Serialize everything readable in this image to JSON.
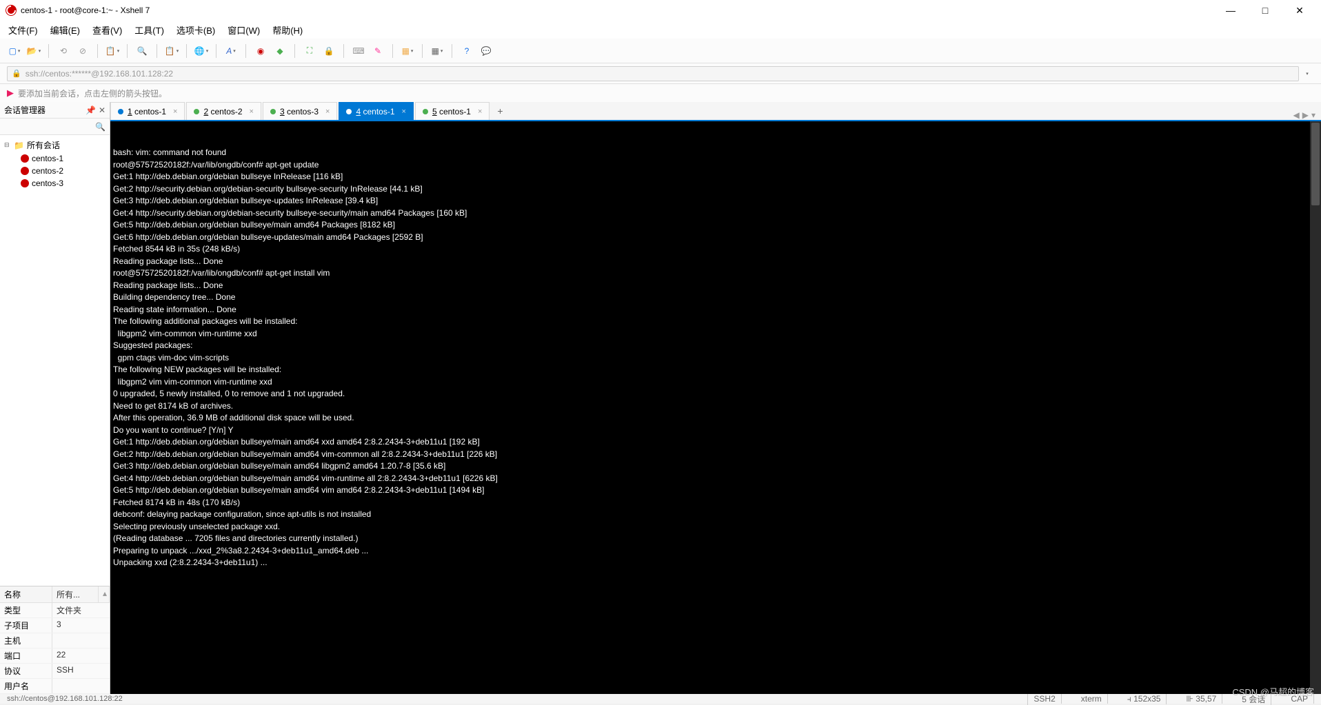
{
  "window": {
    "title": "centos-1 - root@core-1:~ - Xshell 7"
  },
  "menu": {
    "file": "文件(F)",
    "edit": "编辑(E)",
    "view": "查看(V)",
    "tools": "工具(T)",
    "tabs": "选项卡(B)",
    "window": "窗口(W)",
    "help": "帮助(H)"
  },
  "address": {
    "url": "ssh://centos:******@192.168.101.128:22"
  },
  "infobar": {
    "text": "要添加当前会话，点击左侧的箭头按钮。"
  },
  "sidebar": {
    "title": "会话管理器",
    "root": "所有会话",
    "items": [
      "centos-1",
      "centos-2",
      "centos-3"
    ]
  },
  "props": {
    "header_name": "名称",
    "header_all": "所有...",
    "rows": [
      {
        "k": "类型",
        "v": "文件夹"
      },
      {
        "k": "子项目",
        "v": "3"
      },
      {
        "k": "主机",
        "v": ""
      },
      {
        "k": "端口",
        "v": "22"
      },
      {
        "k": "协议",
        "v": "SSH"
      },
      {
        "k": "用户名",
        "v": ""
      }
    ]
  },
  "tabs": {
    "items": [
      {
        "idx": "1",
        "label": "centos-1",
        "dot": "blue",
        "active": false
      },
      {
        "idx": "2",
        "label": "centos-2",
        "dot": "green",
        "active": false
      },
      {
        "idx": "3",
        "label": "centos-3",
        "dot": "green",
        "active": false
      },
      {
        "idx": "4",
        "label": "centos-1",
        "dot": "green",
        "active": true
      },
      {
        "idx": "5",
        "label": "centos-1",
        "dot": "green",
        "active": false
      }
    ]
  },
  "terminal": {
    "lines": [
      "bash: vim: command not found",
      "root@57572520182f:/var/lib/ongdb/conf# apt-get update",
      "Get:1 http://deb.debian.org/debian bullseye InRelease [116 kB]",
      "Get:2 http://security.debian.org/debian-security bullseye-security InRelease [44.1 kB]",
      "Get:3 http://deb.debian.org/debian bullseye-updates InRelease [39.4 kB]",
      "Get:4 http://security.debian.org/debian-security bullseye-security/main amd64 Packages [160 kB]",
      "Get:5 http://deb.debian.org/debian bullseye/main amd64 Packages [8182 kB]",
      "Get:6 http://deb.debian.org/debian bullseye-updates/main amd64 Packages [2592 B]",
      "Fetched 8544 kB in 35s (248 kB/s)",
      "Reading package lists... Done",
      "root@57572520182f:/var/lib/ongdb/conf# apt-get install vim",
      "Reading package lists... Done",
      "Building dependency tree... Done",
      "Reading state information... Done",
      "The following additional packages will be installed:",
      "  libgpm2 vim-common vim-runtime xxd",
      "Suggested packages:",
      "  gpm ctags vim-doc vim-scripts",
      "The following NEW packages will be installed:",
      "  libgpm2 vim vim-common vim-runtime xxd",
      "0 upgraded, 5 newly installed, 0 to remove and 1 not upgraded.",
      "Need to get 8174 kB of archives.",
      "After this operation, 36.9 MB of additional disk space will be used.",
      "Do you want to continue? [Y/n] Y",
      "Get:1 http://deb.debian.org/debian bullseye/main amd64 xxd amd64 2:8.2.2434-3+deb11u1 [192 kB]",
      "Get:2 http://deb.debian.org/debian bullseye/main amd64 vim-common all 2:8.2.2434-3+deb11u1 [226 kB]",
      "Get:3 http://deb.debian.org/debian bullseye/main amd64 libgpm2 amd64 1.20.7-8 [35.6 kB]",
      "Get:4 http://deb.debian.org/debian bullseye/main amd64 vim-runtime all 2:8.2.2434-3+deb11u1 [6226 kB]",
      "Get:5 http://deb.debian.org/debian bullseye/main amd64 vim amd64 2:8.2.2434-3+deb11u1 [1494 kB]",
      "Fetched 8174 kB in 48s (170 kB/s)",
      "debconf: delaying package configuration, since apt-utils is not installed",
      "Selecting previously unselected package xxd.",
      "(Reading database ... 7205 files and directories currently installed.)",
      "Preparing to unpack .../xxd_2%3a8.2.2434-3+deb11u1_amd64.deb ...",
      "Unpacking xxd (2:8.2.2434-3+deb11u1) ..."
    ]
  },
  "status": {
    "left": "ssh://centos@192.168.101.128:22",
    "ssh": "SSH2",
    "term": "xterm",
    "size": "152x35",
    "pos": "35,57",
    "sessions": "5 会话",
    "caps": "CAP"
  },
  "watermark": "CSDN @马超的博客"
}
